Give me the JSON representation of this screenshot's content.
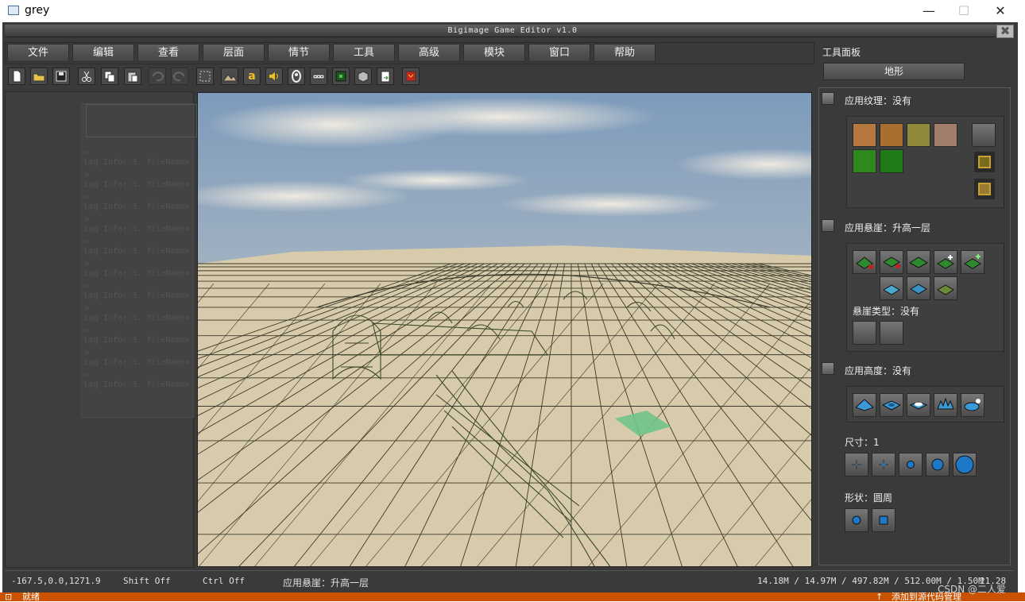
{
  "window": {
    "title": "grey",
    "minimize": "—",
    "maximize": "☐",
    "close": "✕"
  },
  "editor": {
    "title": "Bigimage Game Editor v1.0",
    "close": "✖"
  },
  "menu": [
    "文件",
    "编辑",
    "查看",
    "层面",
    "情节",
    "工具",
    "高级",
    "模块",
    "窗口",
    "帮助"
  ],
  "toolbar_icons": [
    "new-file-icon",
    "open-folder-icon",
    "save-icon",
    "cut-icon",
    "copy-icon",
    "paste-icon",
    "undo-icon",
    "redo-icon",
    "select-rect-icon",
    "terrain-icon",
    "text-a-icon",
    "sound-icon",
    "spawn-icon",
    "road-icon",
    "minimap-icon",
    "object-box-icon",
    "export-icon",
    "record-icon"
  ],
  "log": {
    "lines": [
      "Log Info: 3. fileName=",
      "Log Info: 3. fileName=",
      "Log Info: 3. fileName=",
      "Log Info: 3. fileName=",
      "Log Info: 3. fileName=",
      "Log Info: 3. fileName=",
      "Log Info: 3. fileName=",
      "Log Info: 3. fileName=",
      "Log Info: 3. fileName=",
      "Log Info: 3. fileName=",
      "Log Info: 3. fileName="
    ]
  },
  "panel": {
    "title": "工具面板",
    "mode_button": "地形",
    "texture": {
      "label": "应用纹理：没有",
      "colors": [
        "#b7783e",
        "#a8702f",
        "#8f8a3a",
        "#a27d6c",
        "#2e8a1d",
        "#1f7a1a"
      ]
    },
    "cliff": {
      "label": "应用悬崖：升高一层",
      "type_label": "悬崖类型：没有"
    },
    "height": {
      "label": "应用高度：没有"
    },
    "size": {
      "label": "尺寸：1"
    },
    "shape": {
      "label": "形状：圆周"
    }
  },
  "status": {
    "coords": "-167.5,0.0,1271.9",
    "shift": "Shift Off",
    "ctrl": "Ctrl Off",
    "mode": "应用悬崖：升高一层",
    "memory": "14.18M / 14.97M / 497.82M / 512.00M / 1.50M",
    "fps": "21.28"
  },
  "bottom": {
    "left": "就绪",
    "middle": "添加到源代码管理",
    "watermark": "CSDN @二人爱"
  }
}
